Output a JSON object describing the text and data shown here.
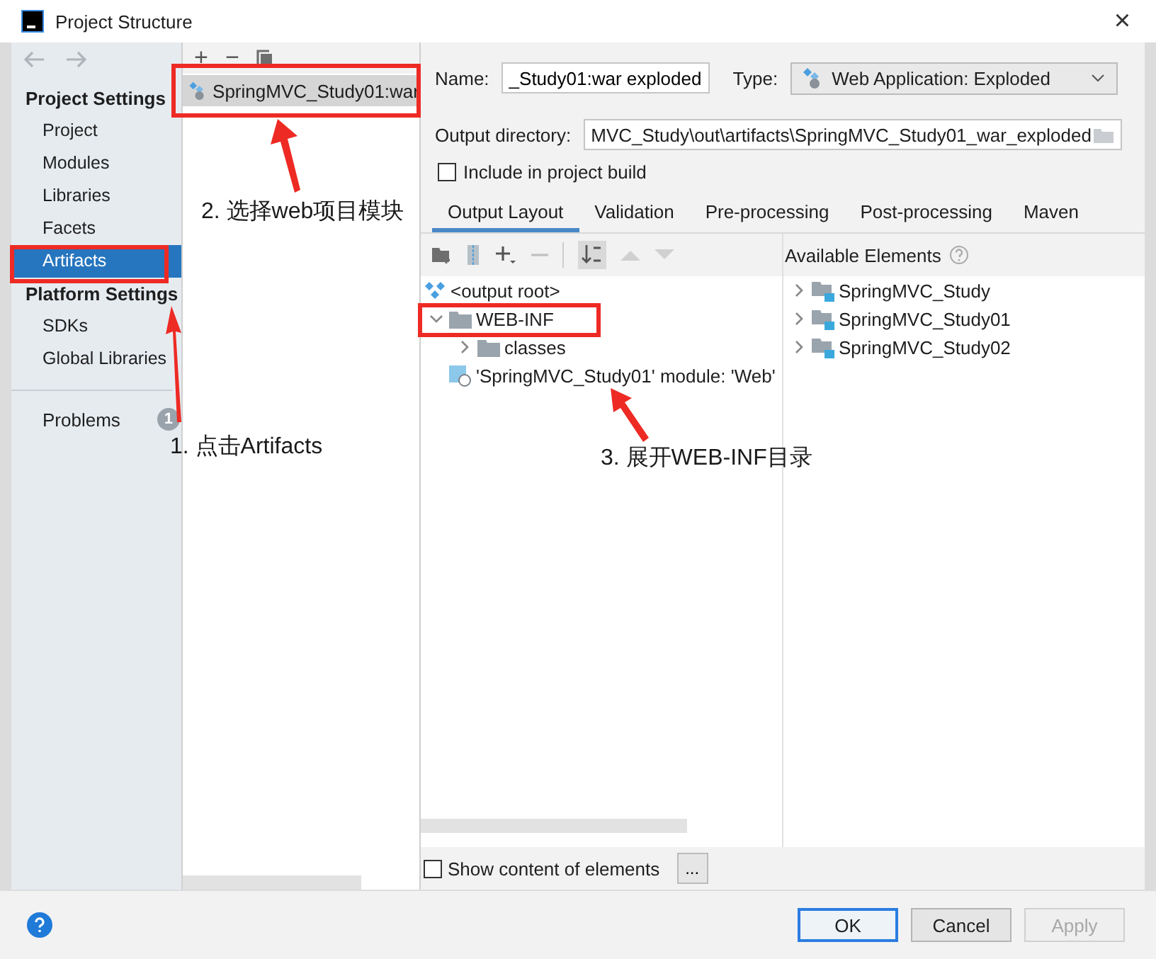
{
  "window": {
    "title": "Project Structure",
    "close": "×"
  },
  "sidebar": {
    "sections": [
      {
        "title": "Project Settings",
        "items": [
          {
            "label": "Project",
            "selected": false
          },
          {
            "label": "Modules",
            "selected": false
          },
          {
            "label": "Libraries",
            "selected": false
          },
          {
            "label": "Facets",
            "selected": false
          },
          {
            "label": "Artifacts",
            "selected": true
          }
        ]
      },
      {
        "title": "Platform Settings",
        "items": [
          {
            "label": "SDKs",
            "selected": false
          },
          {
            "label": "Global Libraries",
            "selected": false
          }
        ]
      }
    ],
    "problems": {
      "label": "Problems",
      "count": "1"
    }
  },
  "artifacts": {
    "toolbar": [
      "+",
      "−"
    ],
    "items": [
      {
        "label": "SpringMVC_Study01:war",
        "selected": true
      }
    ]
  },
  "details": {
    "name_label": "Name:",
    "name_value": "_Study01:war exploded",
    "type_label": "Type:",
    "type_value": "Web Application: Exploded",
    "output_label": "Output directory:",
    "output_value": "MVC_Study\\out\\artifacts\\SpringMVC_Study01_war_exploded",
    "include": {
      "label": "Include in project build",
      "checked": false
    },
    "tabs": [
      {
        "label": "Output Layout",
        "selected": true
      },
      {
        "label": "Validation",
        "selected": false
      },
      {
        "label": "Pre-processing",
        "selected": false
      },
      {
        "label": "Post-processing",
        "selected": false
      },
      {
        "label": "Maven",
        "selected": false
      }
    ],
    "available_title": "Available Elements",
    "layout_tree": [
      {
        "kind": "root",
        "label": "<output root>",
        "children": [
          {
            "kind": "folder",
            "label": "WEB-INF",
            "expanded": true,
            "children": [
              {
                "kind": "folder",
                "label": "classes",
                "expanded": false
              }
            ]
          },
          {
            "kind": "module",
            "label": "'SpringMVC_Study01' module: 'Web'"
          }
        ]
      }
    ],
    "available": [
      {
        "label": "SpringMVC_Study",
        "expanded": false
      },
      {
        "label": "SpringMVC_Study01",
        "expanded": false
      },
      {
        "label": "SpringMVC_Study02",
        "expanded": false
      }
    ],
    "show_content": {
      "label": "Show content of elements",
      "checked": false
    },
    "more_button": "..."
  },
  "buttons": [
    {
      "label": "OK",
      "kind": "default",
      "disabled": false
    },
    {
      "label": "Cancel",
      "kind": "normal",
      "disabled": false
    },
    {
      "label": "Apply",
      "kind": "normal",
      "disabled": true
    }
  ],
  "annotations": [
    {
      "text": "2. 选择web项目模块"
    },
    {
      "text": "1. 点击Artifacts"
    },
    {
      "text": "3. 展开WEB-INF目录"
    }
  ]
}
